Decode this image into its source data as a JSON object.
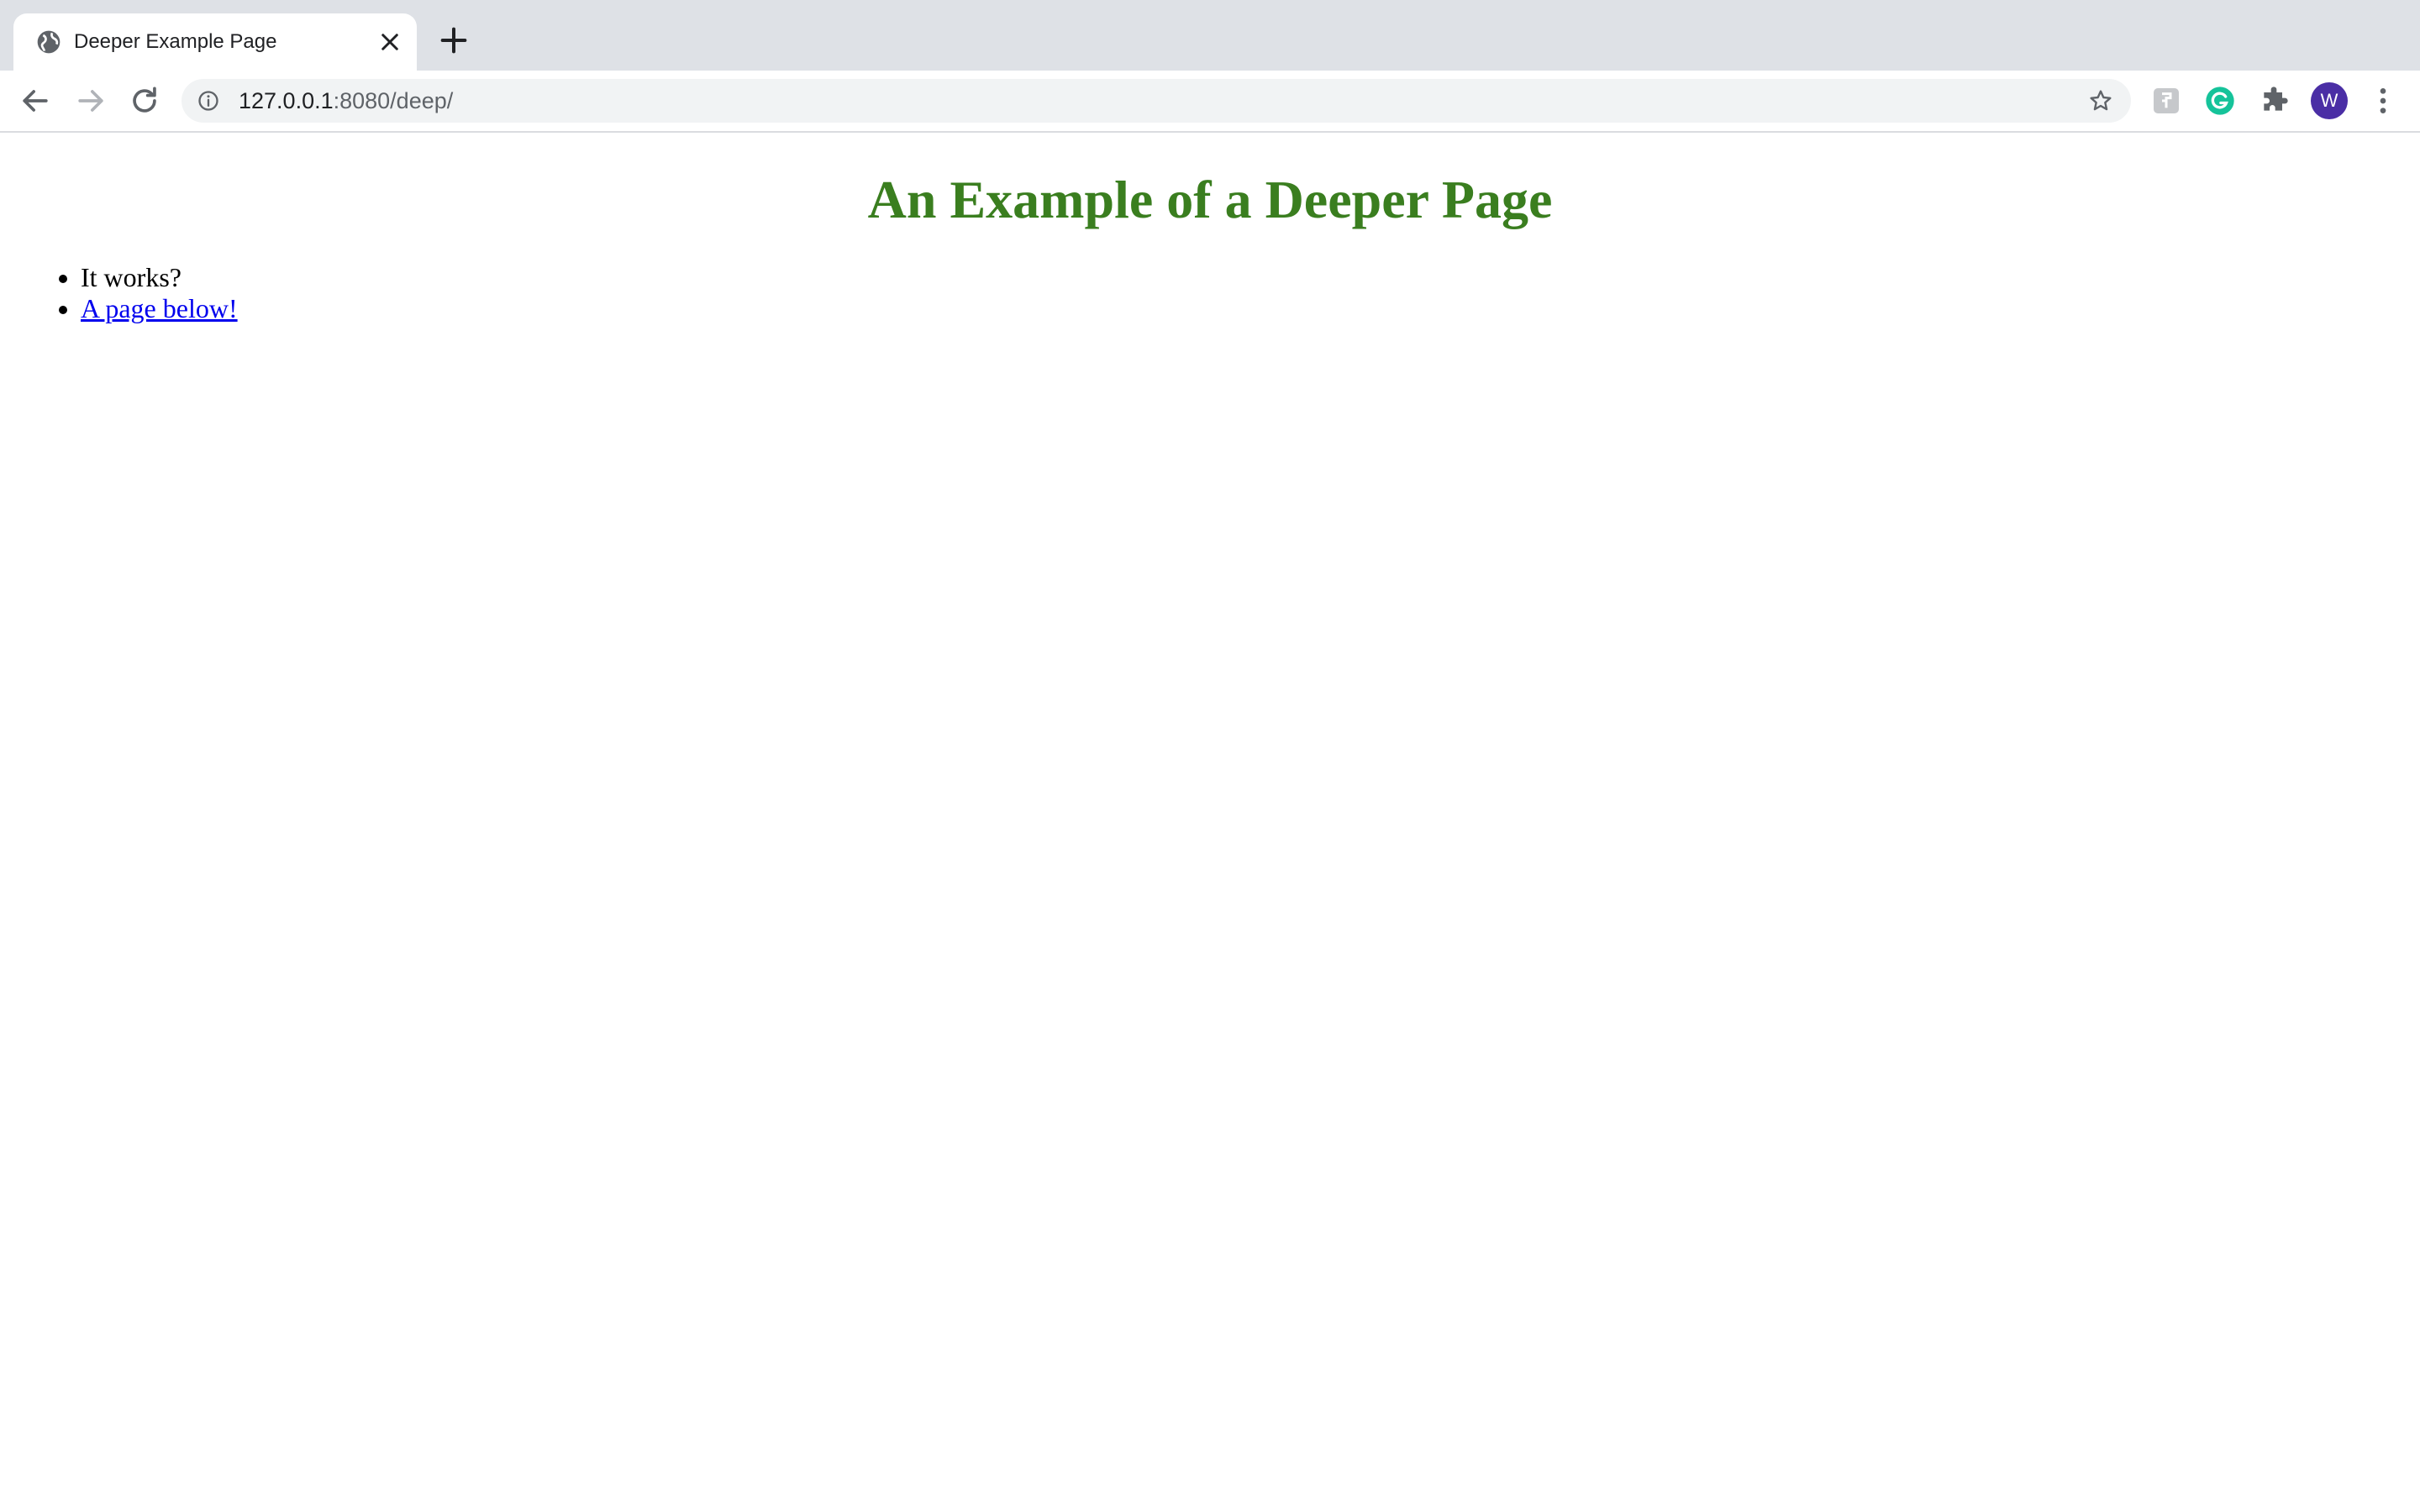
{
  "browser": {
    "tab": {
      "title": "Deeper Example Page",
      "favicon": "globe-icon",
      "close_icon": "close-icon"
    },
    "new_tab_icon": "plus-icon",
    "toolbar": {
      "back_icon": "arrow-left-icon",
      "forward_icon": "arrow-right-icon",
      "reload_icon": "reload-icon",
      "site_info_icon": "info-icon",
      "url_host": "127.0.0.1",
      "url_rest": ":8080/deep/",
      "bookmark_icon": "star-icon",
      "extensions": [
        "puzzle-extension-icon",
        "grammarly-icon",
        "extensions-puzzle-icon"
      ],
      "profile_initial": "W",
      "menu_icon": "kebab-menu-icon"
    },
    "colors": {
      "tabstrip_bg": "#dee1e6",
      "omnibox_bg": "#f1f3f4",
      "avatar_bg": "#4a2ea5",
      "grammarly": "#15c39a"
    }
  },
  "page": {
    "heading": "An Example of a Deeper Page",
    "heading_color": "#3a7e1f",
    "items": [
      {
        "text": "It works?"
      },
      {
        "text": "A page below!",
        "link": true
      }
    ],
    "link_color": "#0000ee"
  }
}
